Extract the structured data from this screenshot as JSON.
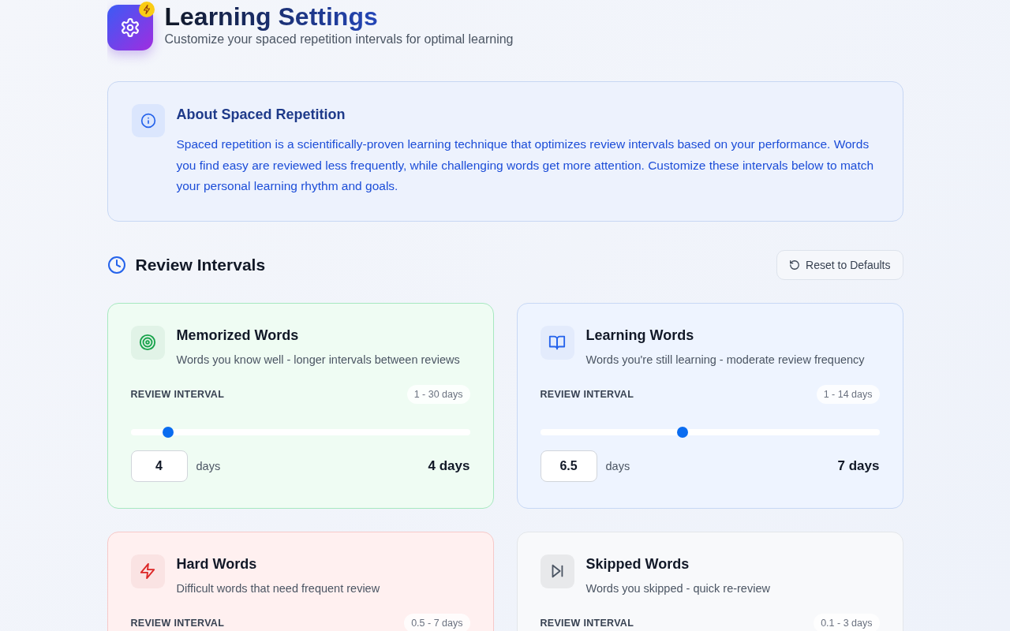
{
  "header": {
    "title": "Learning Settings",
    "subtitle": "Customize your spaced repetition intervals for optimal learning"
  },
  "info": {
    "title": "About Spaced Repetition",
    "text": "Spaced repetition is a scientifically-proven learning technique that optimizes review intervals based on your performance. Words you find easy are reviewed less frequently, while challenging words get more attention. Customize these intervals below to match your personal learning rhythm and goals."
  },
  "section": {
    "title": "Review Intervals",
    "reset_button": "Reset to Defaults"
  },
  "cards": [
    {
      "kind": "target",
      "color": "#16a34a",
      "title": "Memorized Words",
      "description": "Words you know well - longer intervals between reviews",
      "label": "REVIEW INTERVAL",
      "range": "1 - 30 days",
      "level": 0.11,
      "value": "4",
      "unit": "days",
      "result": "4 days"
    },
    {
      "kind": "book",
      "color": "#2563eb",
      "title": "Learning Words",
      "description": "Words you're still learning - moderate review frequency",
      "label": "REVIEW INTERVAL",
      "range": "1 - 14 days",
      "level": 0.42,
      "value": "6.5",
      "unit": "days",
      "result": "7 days"
    },
    {
      "kind": "bolt",
      "color": "#dc2626",
      "title": "Hard Words",
      "description": "Difficult words that need frequent review",
      "label": "REVIEW INTERVAL",
      "range": "0.5 - 7 days"
    },
    {
      "kind": "skip",
      "color": "#4b5563",
      "title": "Skipped Words",
      "description": "Words you skipped - quick re-review",
      "label": "REVIEW INTERVAL",
      "range": "0.1 - 3 days"
    }
  ]
}
